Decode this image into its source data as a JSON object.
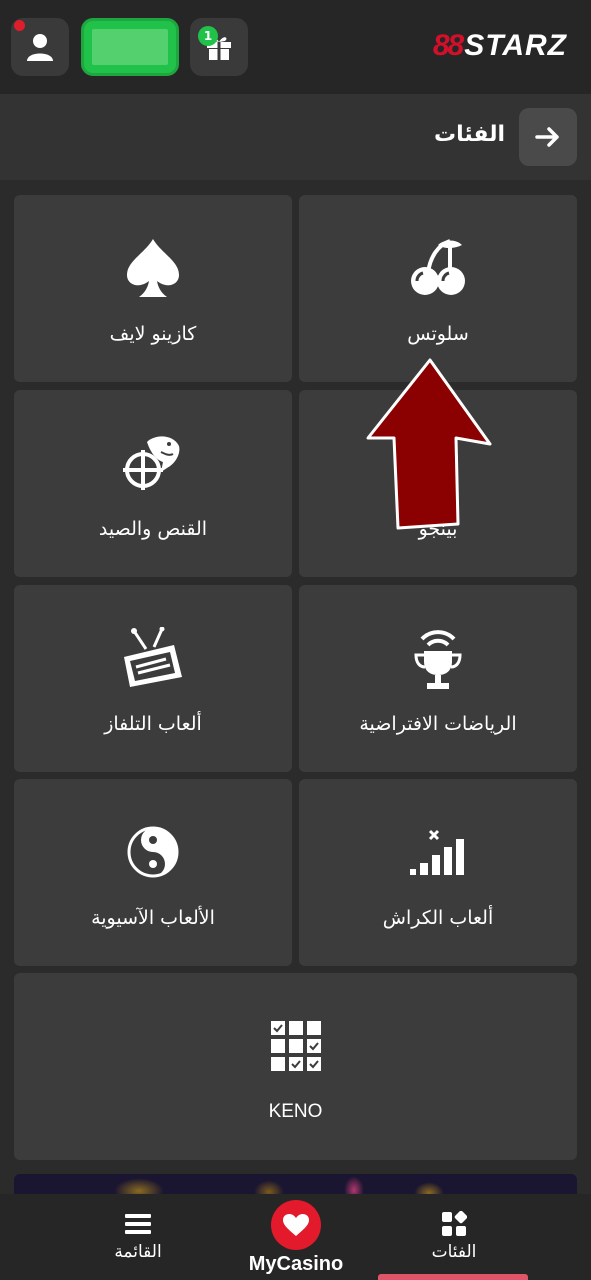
{
  "header": {
    "title": "الفئات",
    "back_icon": "arrow-right-icon"
  },
  "topbar": {
    "logo_prefix": "88",
    "logo_text": "STARZ",
    "gift_badge_count": "1"
  },
  "categories": [
    {
      "label": "سلوتس",
      "icon": "cherries-icon"
    },
    {
      "label": "كازينو لايف",
      "icon": "spade-icon"
    },
    {
      "label": "بينجو",
      "icon": "bingo-icon"
    },
    {
      "label": "القنص والصيد",
      "icon": "fish-crosshair-icon"
    },
    {
      "label": "الرياضات الافتراضية",
      "icon": "trophy-signal-icon"
    },
    {
      "label": "ألعاب التلفاز",
      "icon": "tv-icon"
    },
    {
      "label": "ألعاب الكراش",
      "icon": "crash-bars-icon"
    },
    {
      "label": "الألعاب الآسيوية",
      "icon": "yin-yang-icon"
    },
    {
      "label": "KENO",
      "icon": "keno-grid-icon"
    }
  ],
  "bottom_nav": {
    "menu_label": "القائمة",
    "mycasino_label": "MyCasino",
    "categories_label": "الفئات"
  },
  "colors": {
    "accent_green": "#21c24a",
    "brand_red": "#d3102a",
    "heart_red": "#e21a2b",
    "arrow_red": "#8b0000"
  }
}
